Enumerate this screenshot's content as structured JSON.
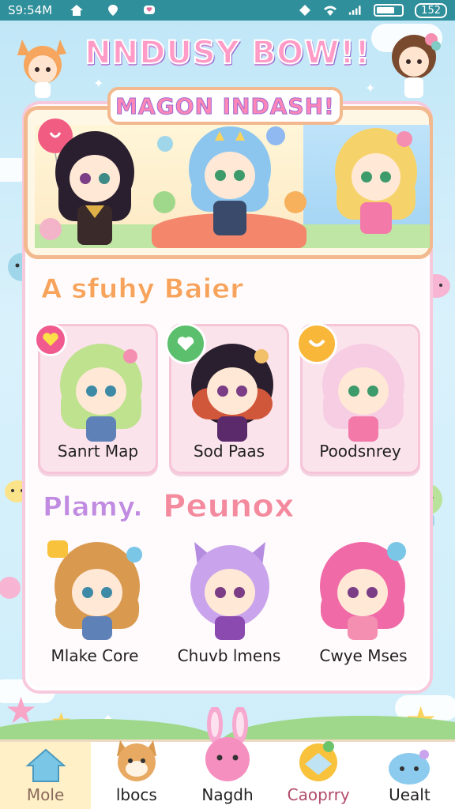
{
  "status_bar": {
    "time": "S9:54M",
    "battery_label": "152",
    "icons": [
      "home-alert-icon",
      "location-pin-icon",
      "chat-heart-icon",
      "sync-diamond-icon",
      "wifi-icon",
      "signal-icon",
      "battery-icon"
    ]
  },
  "app": {
    "title": "NNDUSY BOW!!",
    "banner_title": "MAGON INDASH!"
  },
  "section1": {
    "title": "A sfuhy Baier",
    "cards": [
      {
        "label": "Sanrt Map",
        "badge_icon": "heart-bubble-icon"
      },
      {
        "label": "Sod Paas",
        "badge_icon": "heart-card-icon"
      },
      {
        "label": "Poodsnrey",
        "badge_icon": "smile-bubble-icon"
      }
    ]
  },
  "section2": {
    "title_part1": "Plamy.",
    "title_part2": "Peunox",
    "items": [
      {
        "label": "Mlake Core"
      },
      {
        "label": "Chuvb lmens"
      },
      {
        "label": "Cwye Mses"
      }
    ]
  },
  "bottom_nav": [
    {
      "label": "Mole",
      "icon": "house-icon",
      "active": true
    },
    {
      "label": "lbocs",
      "icon": "fox-face-icon",
      "active": false
    },
    {
      "label": "Nagdh",
      "icon": "bunny-face-icon",
      "active": false
    },
    {
      "label": "Caoprry",
      "icon": "cake-icon",
      "active": false
    },
    {
      "label": "Uealt",
      "icon": "blob-face-icon",
      "active": false
    }
  ],
  "colors": {
    "status_bar": "#2f8f9a",
    "panel_border": "#f7c9dc",
    "banner_border": "#f3b98e",
    "card_bg": "#fbe3ec",
    "nav_active": "#fff0c7"
  }
}
